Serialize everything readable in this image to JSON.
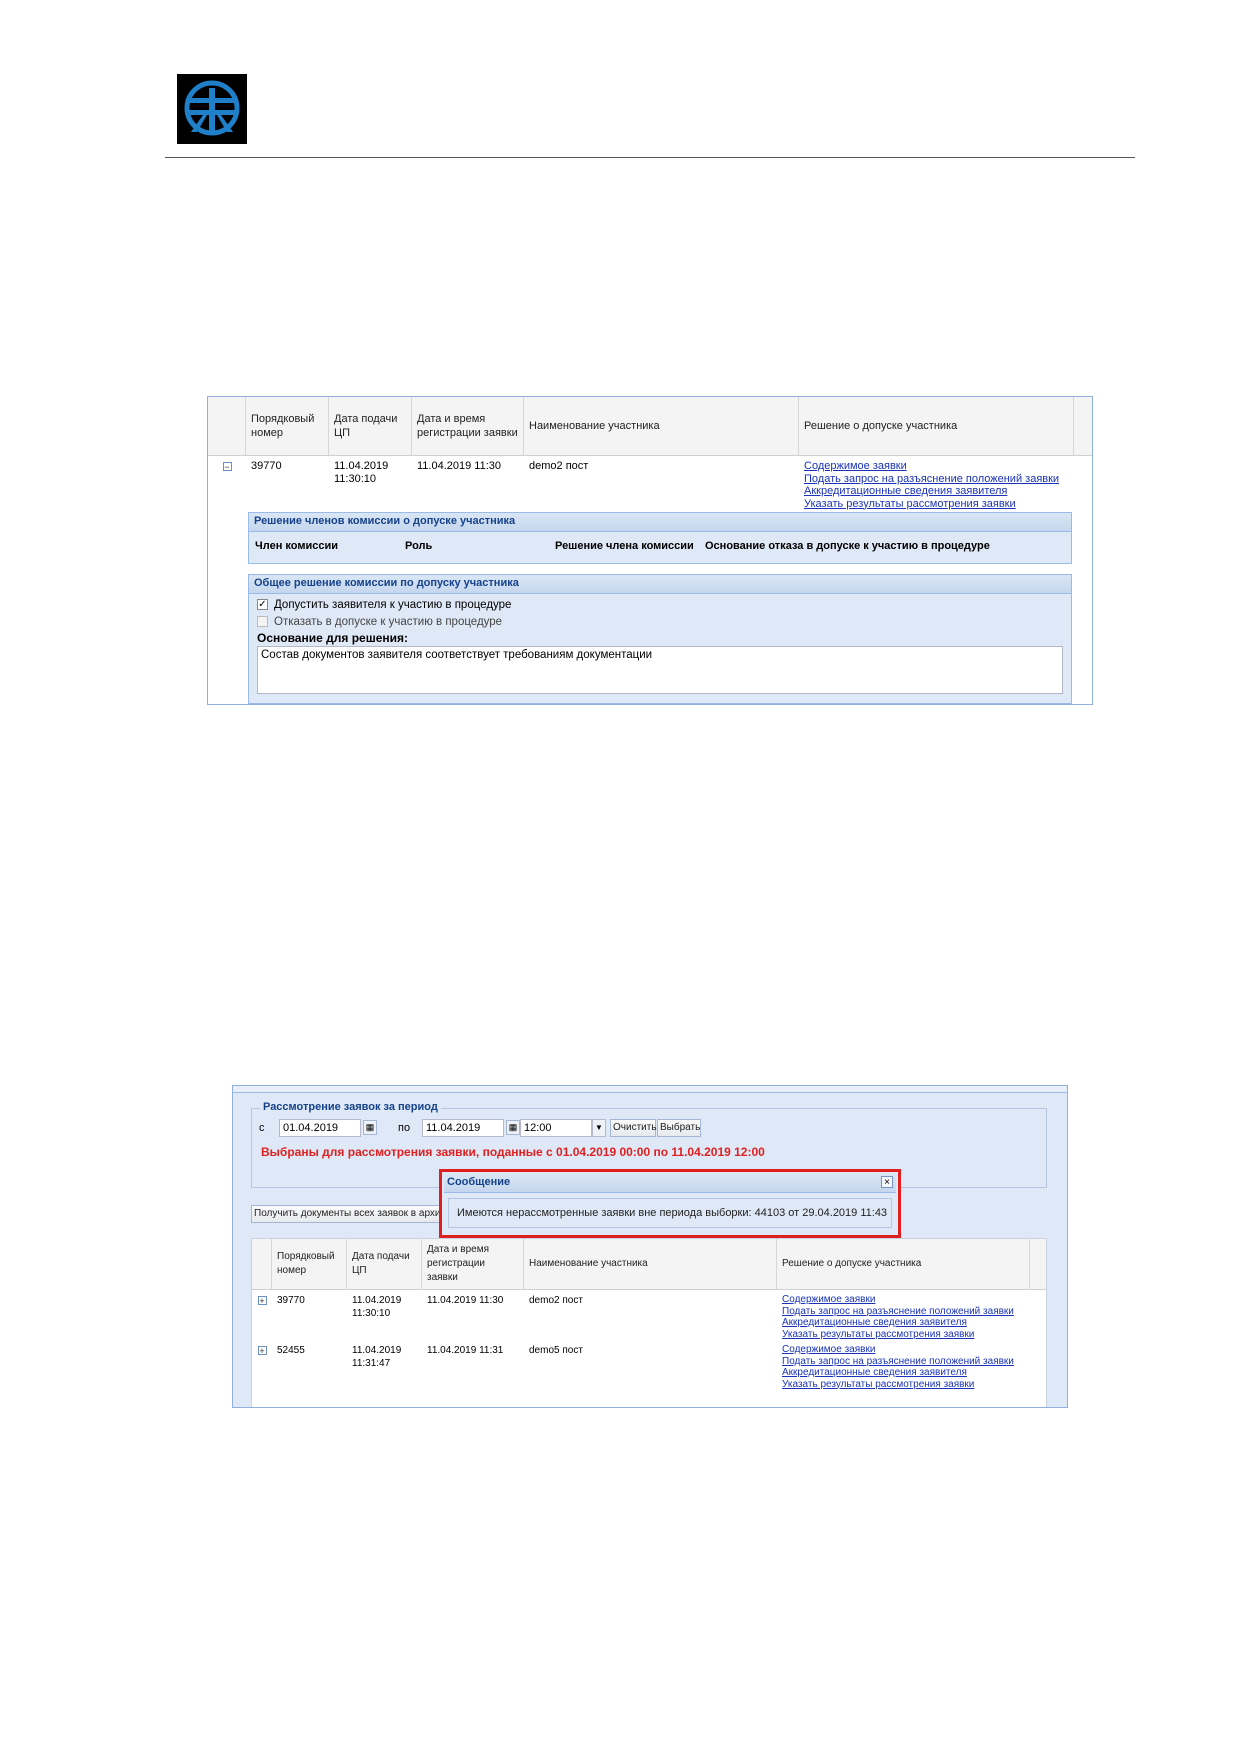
{
  "header": {
    "logo": "company-logo"
  },
  "figure1": {
    "columns": [
      "Порядковый номер",
      "Дата подачи ЦП",
      "Дата и время регистрации заявки",
      "Наименование участника",
      "Решение о допуске участника"
    ],
    "row": {
      "number": "39770",
      "date_line1": "11.04.2019",
      "date_line2": "11:30:10",
      "reg_datetime": "11.04.2019 11:30",
      "participant": "demo2 пост",
      "links": [
        "Содержимое заявки",
        "Подать запрос на разъяснение положений заявки",
        "Аккредитационные сведения заявителя",
        "Указать результаты рассмотрения заявки"
      ]
    },
    "members_panel": {
      "title": "Решение членов комиссии о допуске участника",
      "columns": [
        "Член комиссии",
        "Роль",
        "Решение члена комиссии",
        "Основание отказа в допуске к участию в процедуре"
      ]
    },
    "general_panel": {
      "title": "Общее решение комиссии по допуску участника",
      "option_admit": "Допустить заявителя к участию в процедуре",
      "option_reject": "Отказать в допуске к участию в процедуре",
      "basis_label": "Основание для решения:",
      "basis_text": "Состав документов заявителя соответствует требованиям документации"
    }
  },
  "figure2": {
    "period_legend": "Рассмотрение заявок за период",
    "from_label": "с",
    "from_date": "01.04.2019",
    "to_label": "по",
    "to_date": "11.04.2019",
    "time": "12:00",
    "clear_button": "Очистить",
    "select_button": "Выбрать",
    "selected_note": "Выбраны для рассмотрения заявки, поданные с 01.04.2019 00:00 по 11.04.2019 12:00",
    "archive_button": "Получить документы всех заявок в архиве",
    "dialog": {
      "title": "Сообщение",
      "message": "Имеются нерассмотренные заявки вне периода выборки: 44103 от 29.04.2019 11:43"
    },
    "columns": [
      "Порядковый номер",
      "Дата подачи ЦП",
      "Дата и время регистрации заявки",
      "Наименование участника",
      "Решение о допуске участника"
    ],
    "rows": [
      {
        "number": "39770",
        "date_line1": "11.04.2019",
        "date_line2": "11:30:10",
        "reg_datetime": "11.04.2019 11:30",
        "participant": "demo2 пост",
        "links": [
          "Содержимое заявки",
          "Подать запрос на разъяснение положений заявки",
          "Аккредитационные сведения заявителя",
          "Указать результаты рассмотрения заявки"
        ]
      },
      {
        "number": "52455",
        "date_line1": "11.04.2019",
        "date_line2": "11:31:47",
        "reg_datetime": "11.04.2019 11:31",
        "participant": "demo5 пост",
        "links": [
          "Содержимое заявки",
          "Подать запрос на разъяснение положений заявки",
          "Аккредитационные сведения заявителя",
          "Указать результаты рассмотрения заявки"
        ]
      }
    ]
  },
  "colors": {
    "link": "#1a33b8",
    "alert_red": "#e02020",
    "panel_blue": "#dfe8f6",
    "title_blue": "#15428b",
    "logo_blue": "#1f7fc9"
  }
}
